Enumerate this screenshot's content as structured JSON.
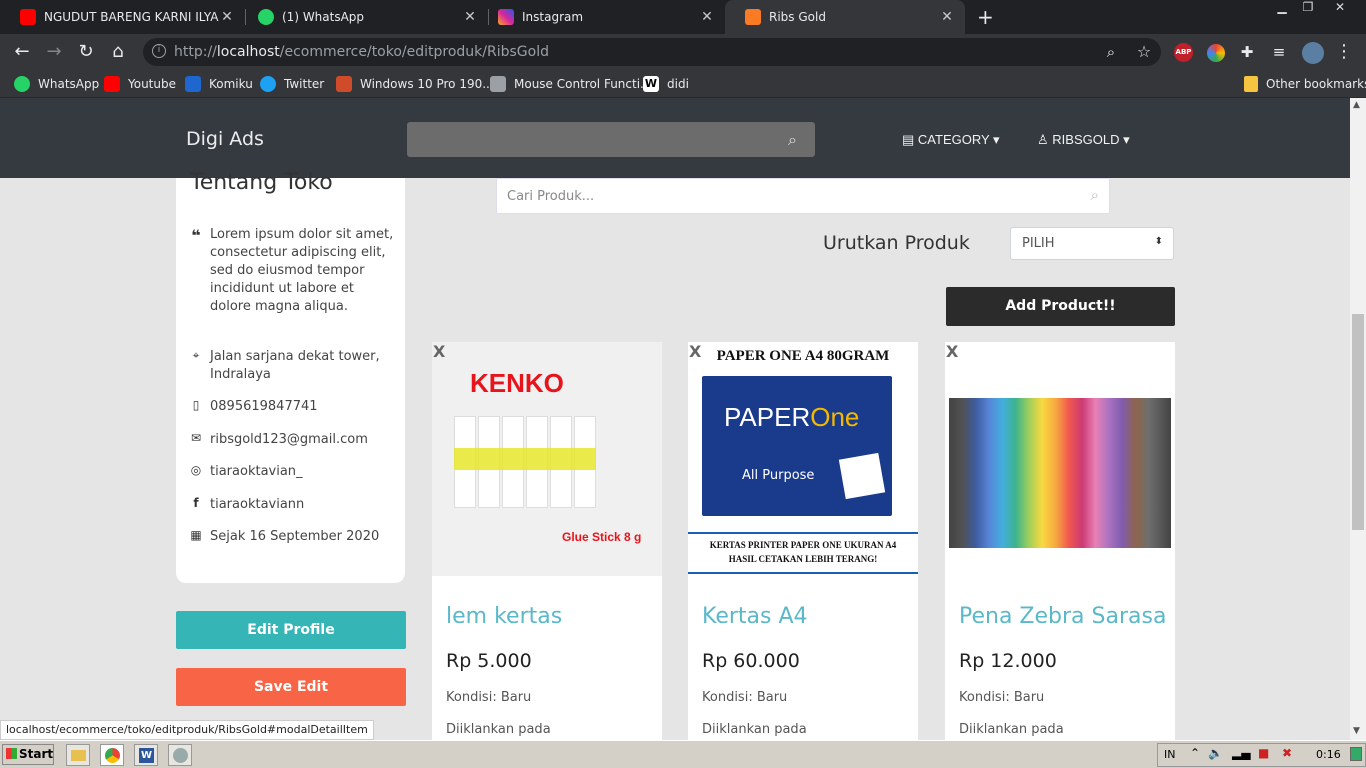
{
  "browser": {
    "tabs": [
      {
        "label": "NGUDUT BARENG KARNI ILYAS□ (",
        "favicon": "youtube-icon",
        "color": "#ff0000"
      },
      {
        "label": "(1) WhatsApp",
        "favicon": "whatsapp-icon",
        "color": "#25d366"
      },
      {
        "label": "Instagram",
        "favicon": "instagram-icon",
        "color": "#d6249f"
      },
      {
        "label": "Ribs Gold",
        "favicon": "xampp-icon",
        "color": "#fb7a24"
      }
    ],
    "url_prefix": "http://",
    "url_host": "localhost",
    "url_path": "/ecommerce/toko/editproduk/RibsGold",
    "bookmarks": [
      {
        "label": "WhatsApp",
        "icon": "whatsapp-icon",
        "color": "#25d366"
      },
      {
        "label": "Youtube",
        "icon": "youtube-icon",
        "color": "#ff0000"
      },
      {
        "label": "Komiku",
        "icon": "komiku-icon",
        "color": "#1e66d0"
      },
      {
        "label": "Twitter",
        "icon": "twitter-icon",
        "color": "#1da1f2"
      },
      {
        "label": "Windows 10 Pro 190...",
        "icon": "windows-icon",
        "color": "#d04b2a"
      },
      {
        "label": "Mouse Control Functi...",
        "icon": "doc-icon",
        "color": "#9aa0a6"
      },
      {
        "label": "didi",
        "icon": "wikipedia-icon",
        "color": "#ffffff"
      }
    ],
    "other_bookmarks": "Other bookmarks",
    "abp_badge": "ABP"
  },
  "navbar": {
    "brand": "Digi Ads",
    "category": "CATEGORY",
    "user": "RIBSGOLD"
  },
  "sidebar": {
    "title": "Tentang Toko",
    "quote": "Lorem ipsum dolor sit amet, consectetur adipiscing elit, sed do eiusmod tempor incididunt ut labore et dolore magna aliqua.",
    "address": "Jalan sarjana dekat tower, Indralaya",
    "phone": "0895619847741",
    "email": "ribsgold123@gmail.com",
    "instagram": "tiaraoktavian_",
    "facebook": "tiaraoktaviann",
    "since": "Sejak 16 September 2020",
    "edit_profile": "Edit Profile",
    "save_edit": "Save Edit"
  },
  "main": {
    "search_placeholder": "Cari Produk...",
    "sort_label": "Urutkan Produk",
    "sort_value": "PILIH",
    "add_product": "Add Product!!",
    "products": [
      {
        "name": "lem kertas",
        "price": "Rp 5.000",
        "condition": "Kondisi: Baru",
        "listed": "Diiklankan pada",
        "img_brand": "KENKO",
        "img_caption": "Glue Stick 8 g"
      },
      {
        "name": "Kertas A4",
        "price": "Rp 60.000",
        "condition": "Kondisi: Baru",
        "listed": "Diiklankan pada",
        "img_title": "PAPER ONE A4 80GRAM",
        "img_logo": "PAPER",
        "img_logo2": "One",
        "img_sub": "All Purpose",
        "img_caption1": "KERTAS PRINTER PAPER ONE UKURAN A4",
        "img_caption2": "HASIL CETAKAN LEBIH TERANG!"
      },
      {
        "name": "Pena Zebra Sarasa",
        "price": "Rp 12.000",
        "condition": "Kondisi: Baru",
        "listed": "Diiklankan pada"
      }
    ],
    "delete_mark": "X"
  },
  "status_url": "localhost/ecommerce/toko/editproduk/RibsGold#modalDetailItem",
  "taskbar": {
    "start": "Start",
    "lang": "IN",
    "time": "0:16"
  }
}
